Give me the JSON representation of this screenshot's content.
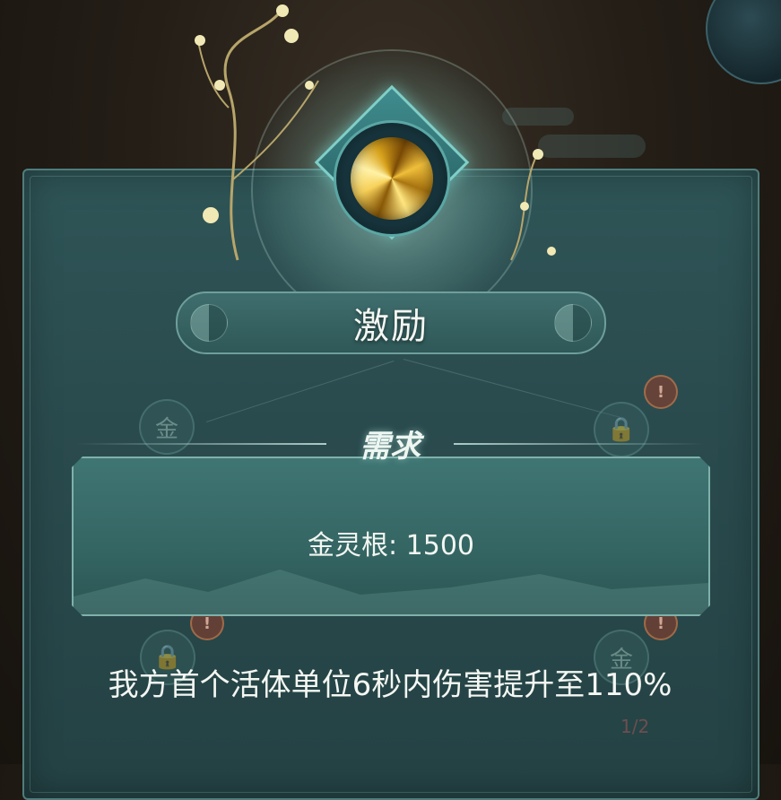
{
  "skill": {
    "title": "激励",
    "icon": "golden-light-icon"
  },
  "requirement": {
    "header": "需求",
    "text": "金灵根: 1500"
  },
  "description": "我方首个活体单位6秒内伤害提升至110%",
  "background": {
    "node_glyph": "金",
    "alert_glyph": "!",
    "page_indicator": "1/2"
  },
  "colors": {
    "panel": "#2f5557",
    "accent": "#7fcfc9",
    "gold": "#f7d15a"
  }
}
